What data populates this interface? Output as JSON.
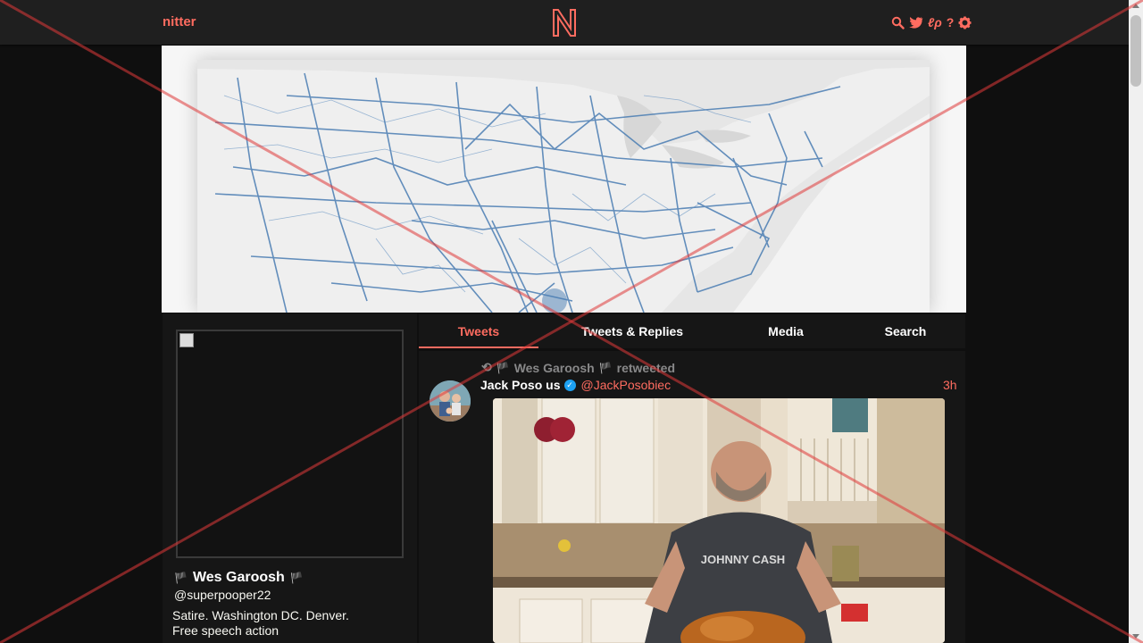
{
  "navbar": {
    "brand": "nitter",
    "logo_letter": "N",
    "icons": [
      "search-icon",
      "bird-icon",
      "rss-icon",
      "help-icon",
      "gear-icon"
    ],
    "rss_label": "ℓρ"
  },
  "colors": {
    "accent": "#ff6c60",
    "background": "#0f0f0f",
    "panel": "#161616",
    "navbar": "#1f1f1f",
    "retweet_gray": "#888889",
    "verified": "#1da1f2"
  },
  "profile": {
    "name": "Wes Garoosh",
    "name_prefix": "🏴",
    "name_suffix": "🏴",
    "handle": "@superpooper22",
    "bio": [
      "Satire. Washington DC. Denver.",
      "Free speech action"
    ]
  },
  "tabs": [
    {
      "label": "Tweets",
      "active": true
    },
    {
      "label": "Tweets & Replies",
      "active": false
    },
    {
      "label": "Media",
      "active": false
    },
    {
      "label": "Search",
      "active": false
    }
  ],
  "tweet": {
    "retweet_icon": "⟲",
    "retweeter": "Wes Garoosh",
    "retweeter_flag": "🏴",
    "retweeted_label": "retweeted",
    "fullname": "Jack Poso us",
    "verified_mark": "✓",
    "username": "@JackPosobiec",
    "date": "3h",
    "media_shirt_text": "JOHNNY CASH"
  }
}
